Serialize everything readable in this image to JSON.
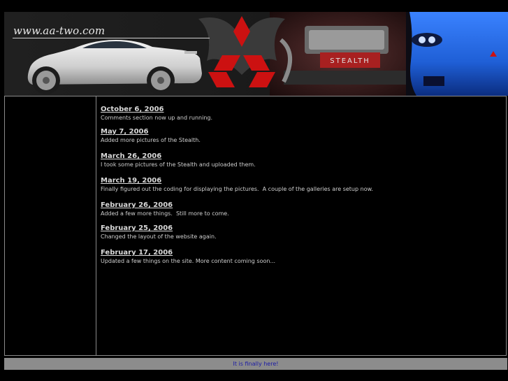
{
  "header": {
    "site_title": "www.aa-two.com",
    "engine_badge": "STEALTH"
  },
  "news": [
    {
      "date": "October 6, 2006",
      "text": "Comments section now up and running."
    },
    {
      "date": "May 7, 2006",
      "text": "Added more pictures of the Stealth."
    },
    {
      "date": "March 26, 2006",
      "text": "I took some pictures of the Stealth and uploaded them."
    },
    {
      "date": "March 19, 2006",
      "text": "Finally figured out the coding for displaying the pictures.  A couple of the galleries are setup now."
    },
    {
      "date": "February 26, 2006",
      "text": "Added a few more things.  Still more to come."
    },
    {
      "date": "February 25, 2006",
      "text": "Changed the layout of the website again."
    },
    {
      "date": "February 17, 2006",
      "text": "Updated a few things on the site. More content coming soon..."
    }
  ],
  "footer": {
    "text": "It is finally here!"
  },
  "colors": {
    "background": "#000000",
    "footer_bar": "#8c8c8c",
    "footer_text": "#1a1aa6",
    "logo_red": "#cc1111",
    "blue_car": "#1f5fd6"
  }
}
